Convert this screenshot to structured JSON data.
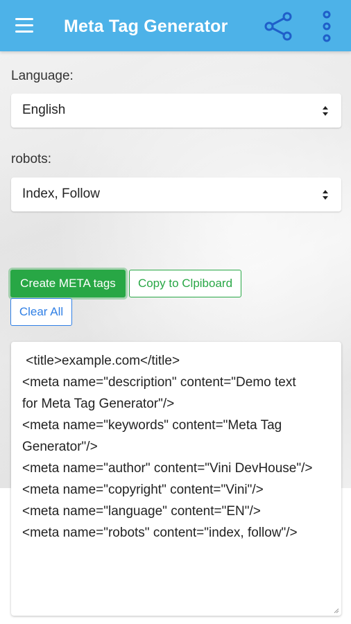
{
  "appbar": {
    "title": "Meta Tag Generator",
    "icons": [
      "menu-icon",
      "share-icon",
      "more-vertical-icon"
    ]
  },
  "form": {
    "language": {
      "label": "Language:",
      "value": "English"
    },
    "robots": {
      "label": "robots:",
      "value": "Index, Follow"
    }
  },
  "buttons": {
    "create": "Create META tags",
    "copy": "Copy to Clpiboard",
    "clear": "Clear All"
  },
  "output": {
    "lines": [
      " <title>example.com</title>",
      "<meta name=\"description\" content=\"Demo text",
      "for Meta Tag Generator\"/>",
      "<meta name=\"keywords\" content=\"Meta Tag",
      "Generator\"/>",
      "<meta name=\"author\" content=\"Vini DevHouse\"/>",
      "<meta name=\"copyright\" content=\"Vini\"/>",
      "<meta name=\"language\" content=\"EN\"/>",
      "<meta name=\"robots\" content=\"index, follow\"/>"
    ]
  },
  "colors": {
    "appbar": "#4db2e8",
    "primary_green": "#28a745",
    "primary_blue": "#2f7fe5"
  }
}
